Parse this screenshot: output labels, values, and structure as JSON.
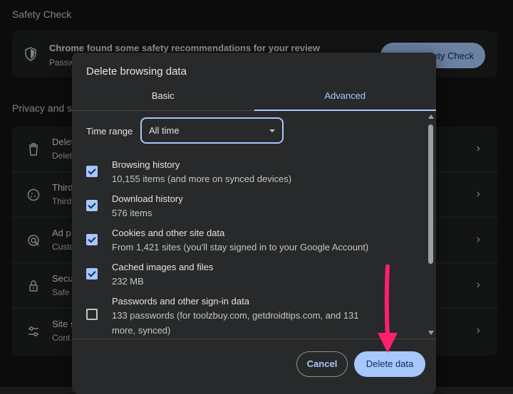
{
  "background": {
    "safety_check": {
      "heading": "Safety Check",
      "title": "Chrome found some safety recommendations for your review",
      "subtitle": "Passw",
      "button": "fety Check"
    },
    "privacy": {
      "heading": "Privacy and s",
      "rows": [
        {
          "icon": "trash-icon",
          "label": "Delet",
          "sub": "Delet"
        },
        {
          "icon": "cookie-icon",
          "label": "Third",
          "sub": "Third"
        },
        {
          "icon": "ad-privacy-icon",
          "label": "Ad p",
          "sub": "Custo"
        },
        {
          "icon": "lock-icon",
          "label": "Secu",
          "sub": "Safe"
        },
        {
          "icon": "tune-icon",
          "label": "Site s",
          "sub": "Cont"
        }
      ]
    }
  },
  "dialog": {
    "title": "Delete browsing data",
    "tabs": [
      {
        "label": "Basic",
        "active": false
      },
      {
        "label": "Advanced",
        "active": true
      }
    ],
    "time_range": {
      "label": "Time range",
      "value": "All time"
    },
    "items": [
      {
        "title": "Browsing history",
        "sub": "10,155 items (and more on synced devices)",
        "checked": true
      },
      {
        "title": "Download history",
        "sub": "576 items",
        "checked": true
      },
      {
        "title": "Cookies and other site data",
        "sub": "From 1,421 sites (you'll stay signed in to your Google Account)",
        "checked": true
      },
      {
        "title": "Cached images and files",
        "sub": "232 MB",
        "checked": true
      },
      {
        "title": "Passwords and other sign-in data",
        "sub": "133 passwords (for toolzbuy.com, getdroidtips.com, and 131 more, synced)",
        "checked": false
      }
    ],
    "cancel_label": "Cancel",
    "delete_label": "Delete data"
  },
  "colors": {
    "accent": "#a8c7fa",
    "annotation_arrow": "#ff1f6d"
  }
}
